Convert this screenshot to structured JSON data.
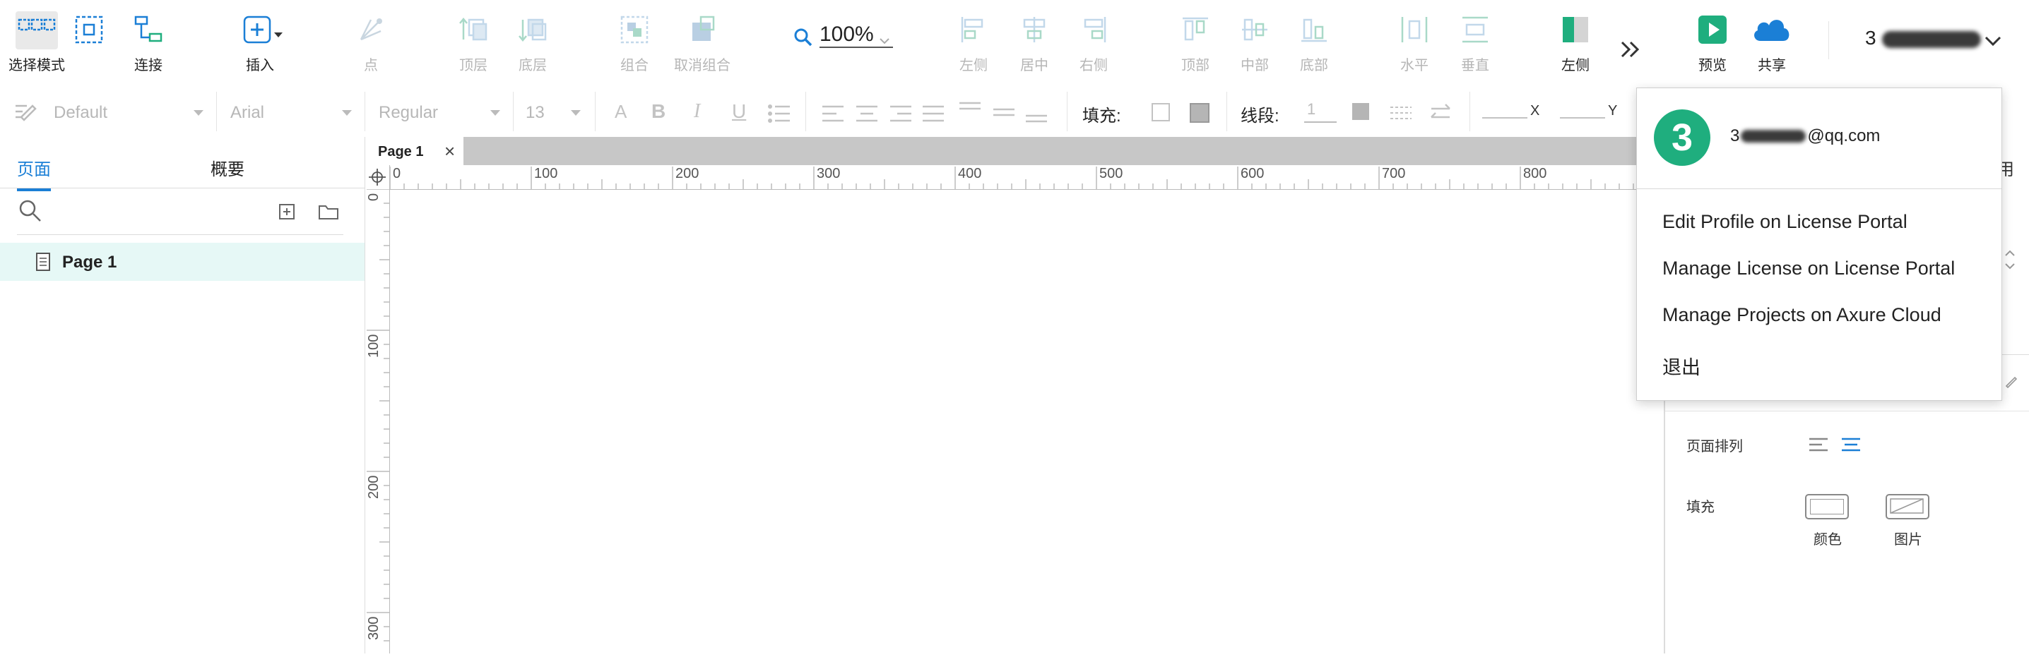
{
  "toolbar": {
    "select_mode": "选择模式",
    "connect": "连接",
    "insert": "插入",
    "point": "点",
    "top_layer": "顶层",
    "bottom_layer": "底层",
    "group": "组合",
    "ungroup": "取消组合",
    "zoom": "100%",
    "align_left": "左侧",
    "align_center": "居中",
    "align_right": "右侧",
    "align_top": "顶部",
    "align_middle": "中部",
    "align_bottom": "底部",
    "dist_horizontal": "水平",
    "dist_vertical": "垂直",
    "left_panel_toggle": "左侧",
    "preview": "预览",
    "share": "共享",
    "user_prefix": "3"
  },
  "format": {
    "style": "Default",
    "font": "Arial",
    "weight": "Regular",
    "size": "13",
    "fill_label": "填充:",
    "stroke_label": "线段:",
    "stroke_value": "1",
    "x_label": "X",
    "y_label": "Y"
  },
  "left_panel": {
    "tab_pages": "页面",
    "tab_outline": "概要",
    "pages": [
      "Page 1"
    ]
  },
  "canvas": {
    "tab_label": "Page 1",
    "ruler_x": [
      "0",
      "100",
      "200",
      "300",
      "400",
      "500",
      "600",
      "700",
      "800"
    ],
    "ruler_y": [
      "0",
      "100",
      "200",
      "300"
    ]
  },
  "right_panel": {
    "partial_tab": "用",
    "page_align_label": "页面排列",
    "fill_label": "填充",
    "fill_color": "颜色",
    "fill_image": "图片"
  },
  "dropdown": {
    "avatar": "3",
    "email_prefix": "3",
    "email_suffix": "@qq.com",
    "items": [
      "Edit Profile on License Portal",
      "Manage License on License Portal",
      "Manage Projects on Axure Cloud",
      "退出"
    ]
  },
  "colors": {
    "accent_blue": "#1b7fd6",
    "teal": "#1fae7e",
    "avatar_green": "#1fae7e"
  }
}
